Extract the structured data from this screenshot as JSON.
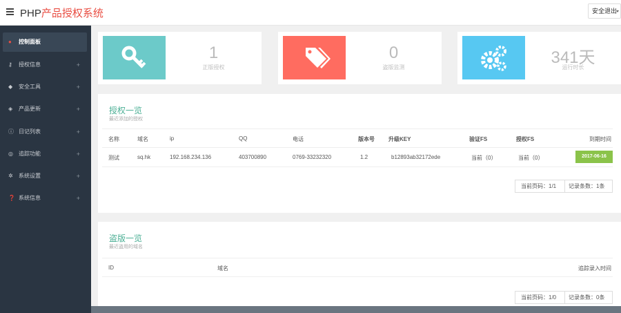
{
  "header": {
    "brand_prefix": "PHP",
    "brand_cn": "产品授权系统",
    "logout_label": "安全退出"
  },
  "sidebar": {
    "items": [
      {
        "label": "控制面板",
        "icon": "dashboard-icon",
        "glyph": "●",
        "active": true
      },
      {
        "label": "授权信息",
        "icon": "key-icon",
        "glyph": "⚷",
        "plus": "+"
      },
      {
        "label": "安全工具",
        "icon": "shield-icon",
        "glyph": "◆",
        "plus": "+"
      },
      {
        "label": "产品更新",
        "icon": "tags-icon",
        "glyph": "◈",
        "plus": "+"
      },
      {
        "label": "日记列表",
        "icon": "info-icon",
        "glyph": "ⓘ",
        "plus": "+"
      },
      {
        "label": "追踪功能",
        "icon": "target-icon",
        "glyph": "◎",
        "plus": "+"
      },
      {
        "label": "系统设置",
        "icon": "gears-icon",
        "glyph": "✲",
        "plus": "+"
      },
      {
        "label": "系统信息",
        "icon": "question-icon",
        "glyph": "❓",
        "plus": "+"
      }
    ]
  },
  "stats": [
    {
      "value": "1",
      "caption": "正版授权",
      "color": "#6ccac9",
      "icon": "key-icon"
    },
    {
      "value": "0",
      "caption": "盗版监测",
      "color": "#ff6c60",
      "icon": "tags-icon"
    },
    {
      "value": "341天",
      "caption": "运行时长",
      "color": "#57c8f2",
      "icon": "gears-icon"
    }
  ],
  "license_panel": {
    "title": "授权一览",
    "subtitle": "最近添加的授权",
    "columns": [
      "名称",
      "域名",
      "ip",
      "QQ",
      "电话",
      "版本号",
      "升级KEY",
      "验证FS",
      "授权FS",
      "到期时间"
    ],
    "rows": [
      {
        "name": "测试",
        "domain": "sq.hk",
        "ip": "192.168.234.136",
        "qq": "403700890",
        "phone": "0769-33232320",
        "version": "1.2",
        "key": "b12893ab32172ede",
        "verify_fs": "当前（0）",
        "auth_fs": "当前（0）",
        "expire": "2017-06-16"
      }
    ],
    "pager": {
      "page": "当前页码：1/1",
      "count": "记录条数：1条"
    }
  },
  "piracy_panel": {
    "title": "盗版一览",
    "subtitle": "最近盗用的域名",
    "columns": [
      "ID",
      "域名",
      "追踪录入时间"
    ],
    "pager": {
      "page": "当前页码：1/0",
      "count": "记录条数：0条"
    }
  }
}
